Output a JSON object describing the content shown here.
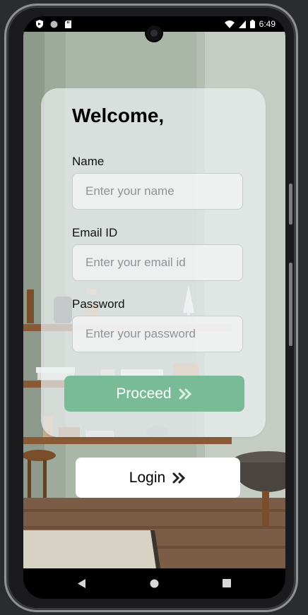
{
  "status_bar": {
    "time": "6:49"
  },
  "form": {
    "heading": "Welcome,",
    "name": {
      "label": "Name",
      "placeholder": "Enter your name"
    },
    "email": {
      "label": "Email ID",
      "placeholder": "Enter your email id"
    },
    "password": {
      "label": "Password",
      "placeholder": "Enter your password"
    },
    "proceed_label": "Proceed"
  },
  "login_label": "Login",
  "colors": {
    "accent": "#79bb97",
    "wall": "#a8b5a7",
    "card_bg": "rgba(236,241,242,0.7)",
    "floor": "#6a4e3a"
  },
  "icons": {
    "status_left": [
      "shield-icon",
      "circle-icon",
      "sd-card-icon"
    ],
    "status_right": [
      "wifi-icon",
      "signal-icon",
      "battery-icon"
    ],
    "nav": [
      "back-icon",
      "home-icon",
      "recents-icon"
    ],
    "buttons": "double-chevron-right-icon"
  }
}
